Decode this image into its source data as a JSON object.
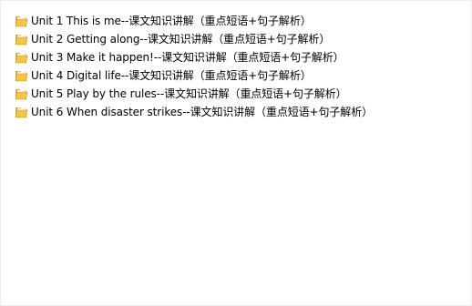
{
  "folders": [
    {
      "name": "Unit 1 This is me--课文知识讲解（重点短语+句子解析）",
      "icon": "folder-icon"
    },
    {
      "name": "Unit 2 Getting along--课文知识讲解（重点短语+句子解析）",
      "icon": "folder-icon"
    },
    {
      "name": "Unit 3 Make it happen!--课文知识讲解（重点短语+句子解析）",
      "icon": "folder-icon"
    },
    {
      "name": "Unit 4 Digital life--课文知识讲解（重点短语+句子解析）",
      "icon": "folder-icon"
    },
    {
      "name": "Unit 5 Play by the rules--课文知识讲解（重点短语+句子解析）",
      "icon": "folder-icon"
    },
    {
      "name": "Unit 6 When disaster strikes--课文知识讲解（重点短语+句子解析）",
      "icon": "folder-icon"
    }
  ],
  "colors": {
    "folder_front": "#f5c542",
    "folder_back": "#e0a92a",
    "folder_paper": "#ffffff"
  }
}
